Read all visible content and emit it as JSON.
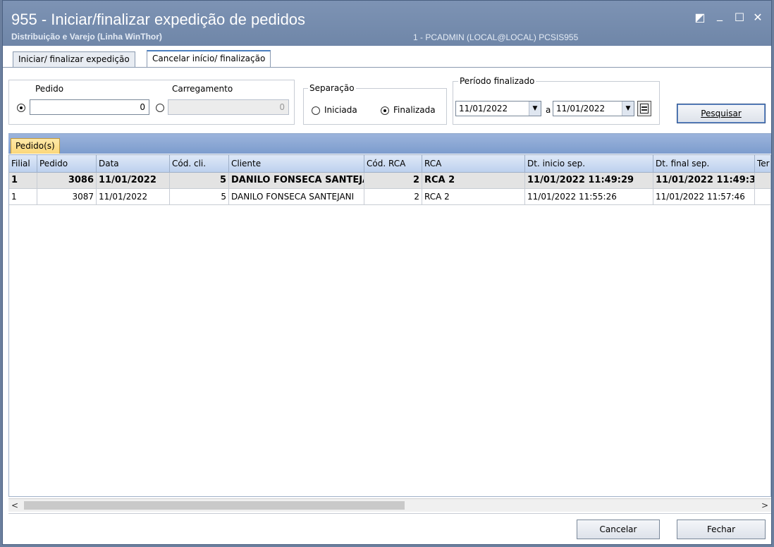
{
  "window": {
    "title": "955 - Iniciar/finalizar expedição de pedidos",
    "subtitle": "Distribuição e Varejo (Linha WinThor)",
    "userinfo": "1 - PCADMIN (LOCAL@LOCAL)  PCSIS955",
    "controls": {
      "restore": "◩",
      "minimize": "_",
      "maximize": "☐",
      "close": "✕"
    }
  },
  "tabs": [
    {
      "label": "Iniciar/ finalizar expedição"
    },
    {
      "label": "Cancelar início/ finalização"
    }
  ],
  "filter": {
    "pedido_label": "Pedido",
    "pedido_value": "0",
    "carregamento_label": "Carregamento",
    "carregamento_value": "0",
    "separacao_label": "Separação",
    "iniciada_label": "Iniciada",
    "finalizada_label": "Finalizada",
    "periodo_label": "Período finalizado",
    "date_from": "11/01/2022",
    "date_sep": "a",
    "date_to": "11/01/2022",
    "search_label": "Pesquisar"
  },
  "subtab": {
    "label": "Pedido(s)"
  },
  "grid": {
    "headers": [
      "Filial",
      "Pedido",
      "Data",
      "Cód. cli.",
      "Cliente",
      "Cód. RCA",
      "RCA",
      "Dt. inicio sep.",
      "Dt. final sep.",
      "Ter"
    ],
    "rows": [
      [
        "1",
        "3086",
        "11/01/2022",
        "5",
        "DANILO FONSECA SANTEJA",
        "2",
        "RCA 2",
        "11/01/2022 11:49:29",
        "11/01/2022 11:49:3",
        ""
      ],
      [
        "1",
        "3087",
        "11/01/2022",
        "5",
        "DANILO FONSECA SANTEJANI",
        "2",
        "RCA 2",
        "11/01/2022 11:55:26",
        "11/01/2022 11:57:46",
        ""
      ]
    ]
  },
  "scroll": {
    "left": "<",
    "right": ">"
  },
  "footer": {
    "cancel_label": "Cancelar",
    "close_label": "Fechar"
  }
}
